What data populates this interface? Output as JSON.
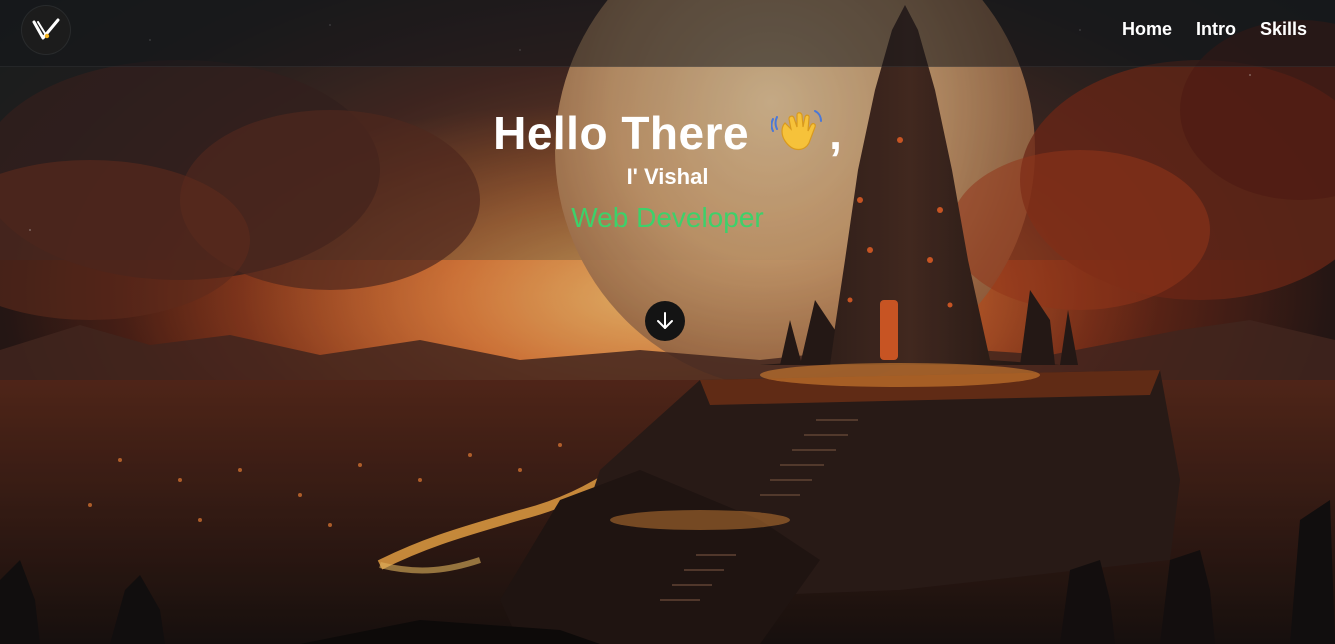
{
  "brand": {
    "logo_icon": "v-logo-icon"
  },
  "nav": {
    "items": [
      {
        "label": "Home"
      },
      {
        "label": "Intro"
      },
      {
        "label": "Skills"
      }
    ]
  },
  "hero": {
    "greeting": "Hello There",
    "wave_icon": "waving-hand-icon",
    "comma": ",",
    "name": "I' Vishal",
    "role": "Web Developer",
    "scroll_icon": "arrow-down-icon"
  },
  "colors": {
    "nav_background": "#14161a",
    "role_text": "#3dd16a",
    "scroll_button": "#141414"
  }
}
